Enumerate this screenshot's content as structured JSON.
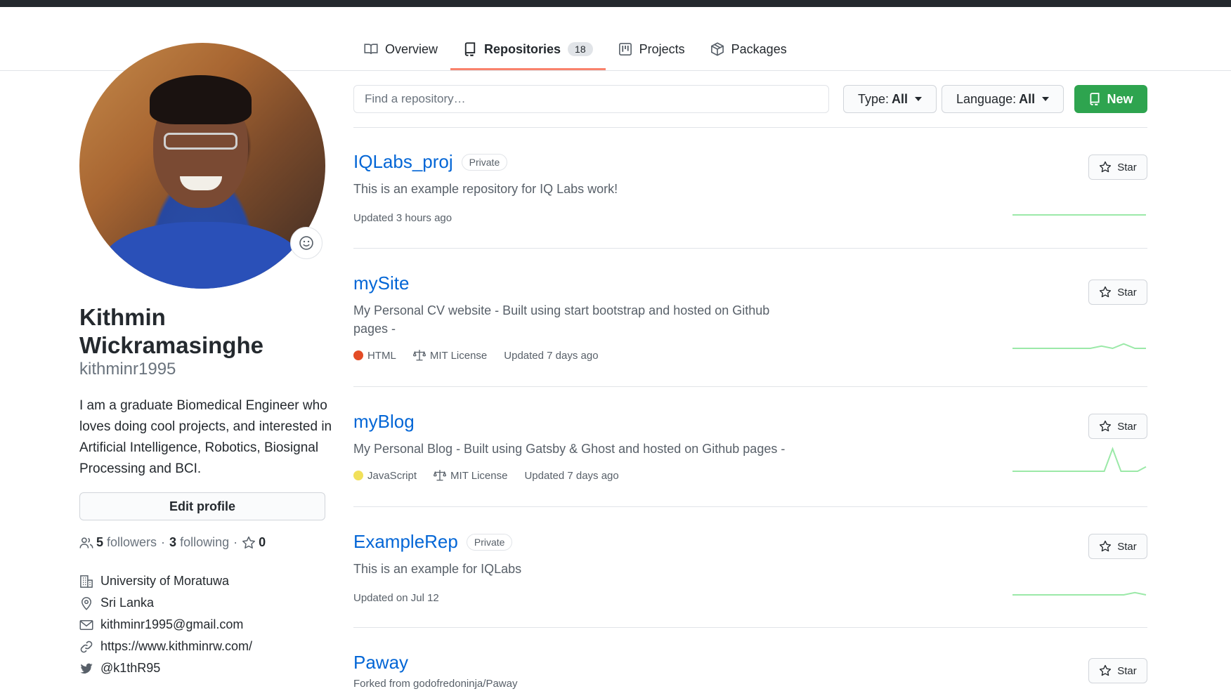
{
  "tabs": [
    {
      "label": "Overview",
      "icon": "book-icon"
    },
    {
      "label": "Repositories",
      "icon": "repo-icon",
      "count": "18",
      "active": true
    },
    {
      "label": "Projects",
      "icon": "project-icon"
    },
    {
      "label": "Packages",
      "icon": "package-icon"
    }
  ],
  "profile": {
    "name_line1": "Kithmin",
    "name_line2": "Wickramasinghe",
    "login": "kithminr1995",
    "bio": "I am a graduate Biomedical Engineer who loves doing cool projects, and interested in Artificial Intelligence, Robotics, Biosignal Processing and BCI.",
    "edit_label": "Edit profile",
    "followers_count": "5",
    "followers_label": "followers",
    "following_count": "3",
    "following_label": "following",
    "stars_count": "0",
    "separator": "·",
    "organization": "University of Moratuwa",
    "location": "Sri Lanka",
    "email": "kithminr1995@gmail.com",
    "website": "https://www.kithminrw.com/",
    "twitter": "@k1thR95"
  },
  "filters": {
    "search_placeholder": "Find a repository…",
    "type_label": "Type:",
    "type_value": "All",
    "language_label": "Language:",
    "language_value": "All",
    "new_label": "New"
  },
  "star_label": "Star",
  "colors": {
    "accent": "#f9826c",
    "link": "#0366d6",
    "green": "#2ea44f",
    "html": "#e34c26",
    "javascript": "#f1e05a",
    "spark": "#9be9a8"
  },
  "repos": [
    {
      "name": "IQLabs_proj",
      "badge": "Private",
      "description": "This is an example repository for IQ Labs work!",
      "updated": "Updated 3 hours ago",
      "spark": [
        0,
        0,
        0,
        0,
        0,
        0,
        0,
        0,
        0,
        0,
        0,
        0
      ]
    },
    {
      "name": "mySite",
      "description": "My Personal CV website - Built using start bootstrap and hosted on Github pages -",
      "language": "HTML",
      "license": "MIT License",
      "updated": "Updated 7 days ago",
      "spark": [
        0,
        0,
        0,
        0,
        0,
        0,
        0,
        0,
        1,
        0,
        2,
        0,
        0
      ]
    },
    {
      "name": "myBlog",
      "description": "My Personal Blog - Built using Gatsby & Ghost and hosted on Github pages -",
      "language": "JavaScript",
      "license": "MIT License",
      "updated": "Updated 7 days ago",
      "spark": [
        0,
        0,
        0,
        0,
        0,
        0,
        0,
        0,
        0,
        0,
        0,
        0,
        10,
        0,
        0,
        0,
        2
      ]
    },
    {
      "name": "ExampleRep",
      "badge": "Private",
      "description": "This is an example for IQLabs",
      "updated": "Updated on Jul 12",
      "spark": [
        0,
        0,
        0,
        0,
        0,
        0,
        0,
        0,
        0,
        0,
        0,
        1,
        0
      ]
    },
    {
      "name": "Paway",
      "forked": "Forked from godofredoninja/Paway"
    }
  ]
}
